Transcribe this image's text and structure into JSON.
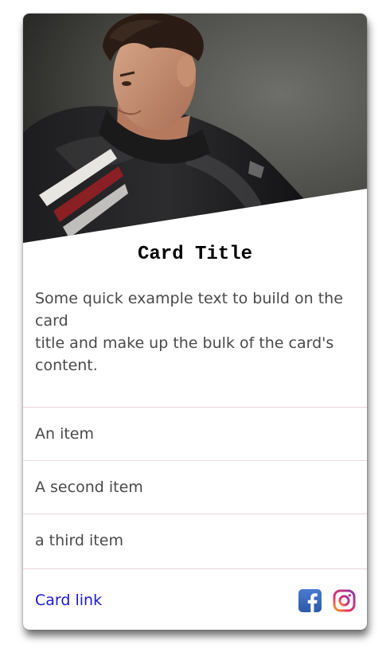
{
  "card": {
    "image_alt": "Portrait of a young man in a black leather jacket",
    "title": "Card Title",
    "text_line1": "Some quick example text to build on the card",
    "text_line2": "title and make up the bulk of the card's content.",
    "items": [
      "An item",
      "A second item",
      "a third item"
    ],
    "link_label": "Card link",
    "icons": [
      "facebook-icon",
      "instagram-icon"
    ]
  },
  "colors": {
    "link": "#1a1ad6",
    "text": "#4a4a4a",
    "divider": "#ead4da",
    "facebook": "#3a66b8"
  }
}
